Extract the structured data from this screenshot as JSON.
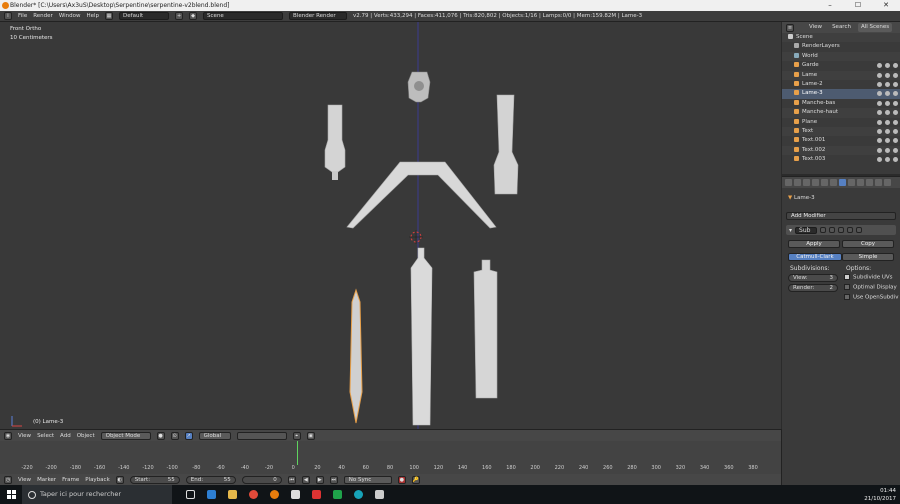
{
  "window": {
    "title": "Blender* [C:\\Users\\Ax3uS\\Desktop\\Serpentine\\serpentine-v2blend.blend]"
  },
  "infobar": {
    "menus": [
      "File",
      "Render",
      "Window",
      "Help"
    ],
    "layout": "Default",
    "scene": "Scene",
    "engine": "Blender Render",
    "stats": "v2.79 | Verts:433,294 | Faces:411,076 | Tris:820,802 | Objects:1/16 | Lamps:0/0 | Mem:159.82M | Lame-3"
  },
  "viewport": {
    "view_name": "Front Ortho",
    "scale": "10 Centimeters",
    "active_object": "(0) Lame-3"
  },
  "outliner": {
    "tabs": [
      "View",
      "Search",
      "All Scenes"
    ],
    "items": [
      {
        "label": "Scene",
        "indent": 0
      },
      {
        "label": "RenderLayers",
        "indent": 1
      },
      {
        "label": "World",
        "indent": 1
      },
      {
        "label": "Garde",
        "indent": 1
      },
      {
        "label": "Lame",
        "indent": 1
      },
      {
        "label": "Lame-2",
        "indent": 1
      },
      {
        "label": "Lame-3",
        "indent": 1
      },
      {
        "label": "Manche-bas",
        "indent": 1
      },
      {
        "label": "Manche-haut",
        "indent": 1
      },
      {
        "label": "Plane",
        "indent": 1
      },
      {
        "label": "Text",
        "indent": 1
      },
      {
        "label": "Text.001",
        "indent": 1
      },
      {
        "label": "Text.002",
        "indent": 1
      },
      {
        "label": "Text.003",
        "indent": 1
      }
    ]
  },
  "properties": {
    "object_name": "Lame-3",
    "add_modifier": "Add Modifier",
    "modifier_name": "Sub",
    "apply": "Apply",
    "copy": "Copy",
    "mode_catmull": "Catmull-Clark",
    "mode_simple": "Simple",
    "subdivisions_label": "Subdivisions:",
    "options_label": "Options:",
    "view_label": "View:",
    "view_value": "3",
    "render_label": "Render:",
    "render_value": "2",
    "subdivide_uvs": "Subdivide UVs",
    "optimal_display": "Optimal Display",
    "use_opensubdiv": "Use OpenSubdiv"
  },
  "view_header": {
    "menus": [
      "View",
      "Select",
      "Add",
      "Object"
    ],
    "mode": "Object Mode",
    "orientation": "Global"
  },
  "timeline": {
    "ticks": [
      "-220",
      "-200",
      "-180",
      "-160",
      "-140",
      "-120",
      "-100",
      "-80",
      "-60",
      "-40",
      "-20",
      "0",
      "20",
      "40",
      "60",
      "80",
      "100",
      "120",
      "140",
      "160",
      "180",
      "200",
      "220",
      "240",
      "260",
      "280",
      "300",
      "320",
      "340",
      "360",
      "380"
    ],
    "menus": [
      "View",
      "Marker",
      "Frame",
      "Playback"
    ],
    "start_label": "Start:",
    "start_value": "55",
    "end_label": "End:",
    "end_value": "55",
    "current_frame": "0",
    "sync": "No Sync"
  },
  "taskbar": {
    "search_placeholder": "Taper ici pour rechercher",
    "time": "01:44",
    "date": "21/10/2017"
  },
  "colors": {
    "accent": "#5680c2",
    "object_orange": "#e8a04a",
    "frame_line": "#5fd35f"
  }
}
